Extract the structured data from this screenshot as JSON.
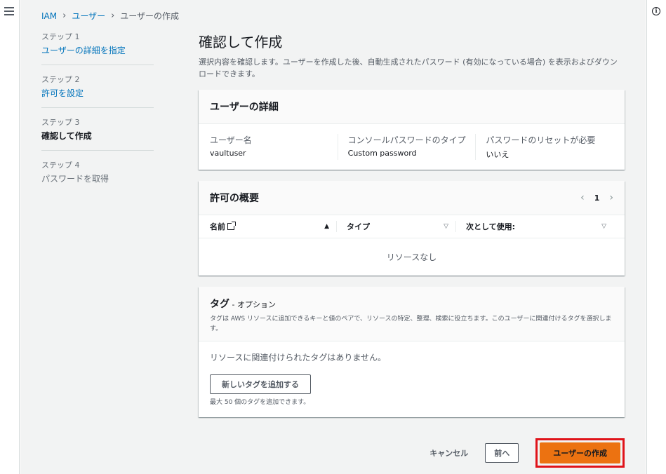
{
  "breadcrumb": {
    "items": [
      "IAM",
      "ユーザー"
    ],
    "current": "ユーザーの作成"
  },
  "steps": [
    {
      "num": "ステップ 1",
      "label": "ユーザーの詳細を指定",
      "state": "link"
    },
    {
      "num": "ステップ 2",
      "label": "許可を設定",
      "state": "link"
    },
    {
      "num": "ステップ 3",
      "label": "確認して作成",
      "state": "active"
    },
    {
      "num": "ステップ 4",
      "label": "パスワードを取得",
      "state": "disabled"
    }
  ],
  "page": {
    "title": "確認して作成",
    "description": "選択内容を確認します。ユーザーを作成した後、自動生成されたパスワード (有効になっている場合) を表示およびダウンロードできます。"
  },
  "user_details": {
    "title": "ユーザーの詳細",
    "fields": [
      {
        "label": "ユーザー名",
        "value": "vaultuser"
      },
      {
        "label": "コンソールパスワードのタイプ",
        "value": "Custom password"
      },
      {
        "label": "パスワードのリセットが必要",
        "value": "いいえ"
      }
    ]
  },
  "permissions": {
    "title": "許可の概要",
    "page": "1",
    "columns": [
      "名前",
      "タイプ",
      "次として使用:"
    ],
    "empty": "リソースなし"
  },
  "tags": {
    "title": "タグ",
    "optional": " - オプション",
    "description": "タグは AWS リソースに追加できるキーと値のペアで、リソースの特定、整理、検索に役立ちます。このユーザーに関連付けるタグを選択します。",
    "empty": "リソースに関連付けられたタグはありません。",
    "add_button": "新しいタグを追加する",
    "limit": "最大 50 個のタグを追加できます。"
  },
  "actions": {
    "cancel": "キャンセル",
    "previous": "前へ",
    "create": "ユーザーの作成"
  },
  "colors": {
    "primary": "#ec7211",
    "link": "#0073bb",
    "highlight": "#e0131a"
  }
}
